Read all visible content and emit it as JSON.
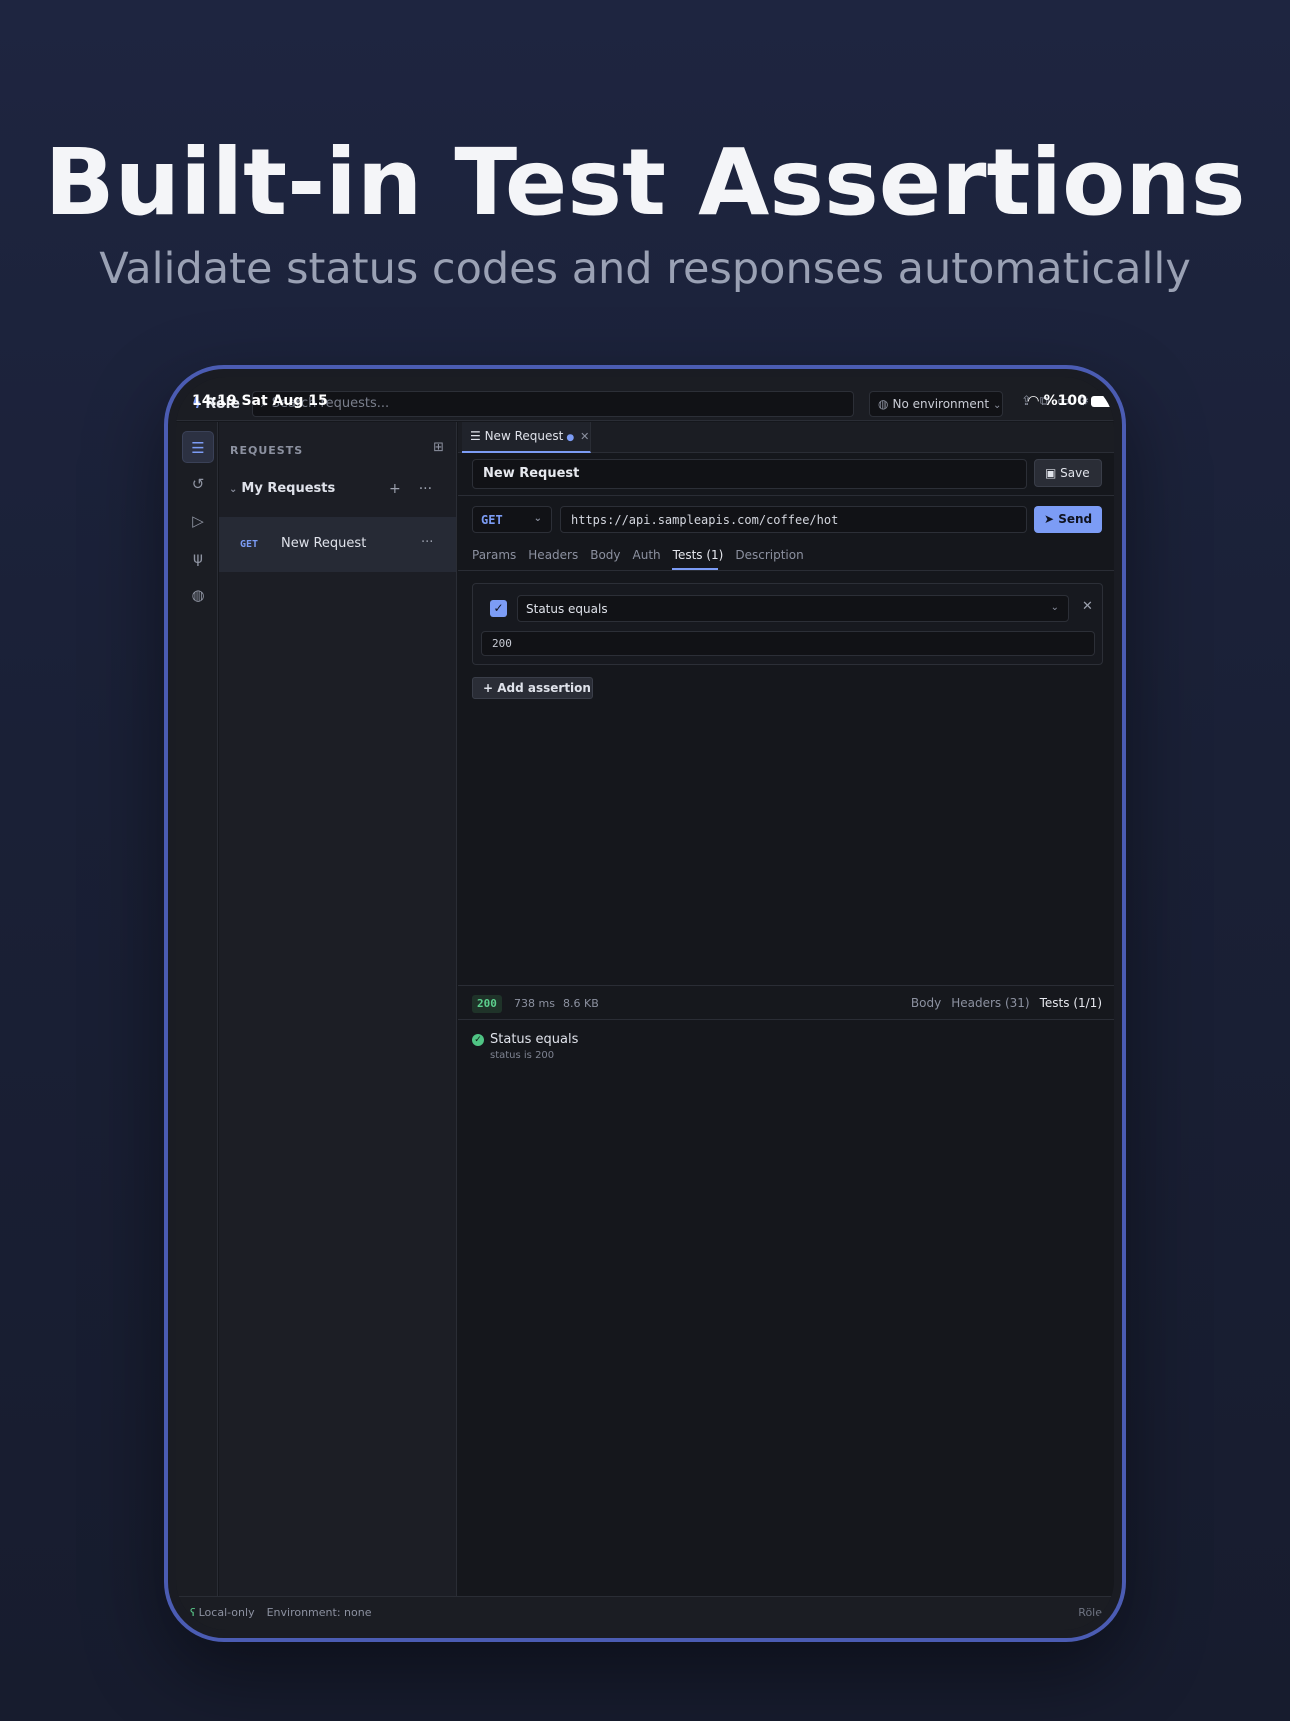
{
  "hero": {
    "title": "Built-in Test Assertions",
    "subtitle": "Validate status codes and responses automatically"
  },
  "status_bar": {
    "time": "14:19",
    "date": "Sat Aug 15",
    "battery": "%100"
  },
  "topbar": {
    "app_name": "Röle",
    "search_placeholder": "Search requests...",
    "environment": "No environment"
  },
  "sidebar": {
    "header": "REQUESTS",
    "folder": "My Requests",
    "requests": [
      {
        "method": "GET",
        "name": "New Request"
      }
    ]
  },
  "editor": {
    "tab_name": "New Request",
    "request_name": "New Request",
    "save_label": "Save",
    "method": "GET",
    "url": "https://api.sampleapis.com/coffee/hot",
    "send_label": "Send",
    "tabs": [
      "Params",
      "Headers",
      "Body",
      "Auth",
      "Tests (1)",
      "Description"
    ],
    "active_tab": "Tests (1)",
    "assertion": {
      "enabled": true,
      "type": "Status equals",
      "value": "200"
    },
    "add_assertion_label": "Add assertion"
  },
  "response": {
    "status_code": "200",
    "time": "738 ms",
    "size": "8.6 KB",
    "tabs": [
      "Body",
      "Headers (31)",
      "Tests (1/1)"
    ],
    "active_tab": "Tests (1/1)",
    "results": [
      {
        "name": "Status equals",
        "detail": "status is 200",
        "passed": true
      }
    ]
  },
  "footer": {
    "mode": "Local-only",
    "environment": "Environment: none",
    "brand": "Röle"
  },
  "colors": {
    "accent": "#7c9cf5",
    "success": "#5ccf8d",
    "device_border": "#4b5cb3"
  }
}
